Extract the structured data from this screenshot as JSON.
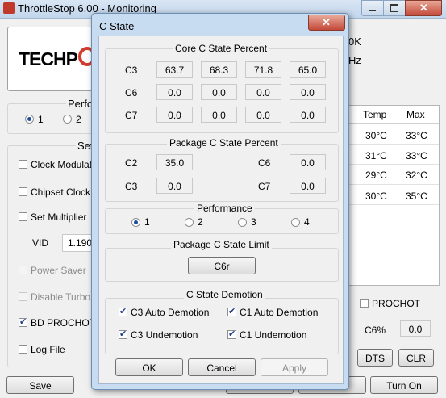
{
  "main_window": {
    "title": "ThrottleStop 6.00 - Monitoring",
    "logo_text": "TECHP",
    "header_right_1": "0K",
    "header_right_2": "Hz",
    "performance_label": "Perfo",
    "perf_radio_1": "1",
    "perf_radio_2": "2",
    "settings_label": "Set",
    "options": [
      {
        "label": "Clock Modulation",
        "checked": false,
        "enabled": true
      },
      {
        "label": "Chipset Clock M",
        "checked": false,
        "enabled": true
      },
      {
        "label": "Set Multiplier",
        "checked": false,
        "enabled": true
      },
      {
        "label": "Power Saver",
        "checked": false,
        "enabled": false
      },
      {
        "label": "Disable Turbo",
        "checked": false,
        "enabled": false
      },
      {
        "label": "BD PROCHOT",
        "checked": true,
        "enabled": true
      },
      {
        "label": "Log File",
        "checked": false,
        "enabled": true
      }
    ],
    "vid_label": "VID",
    "vid_value": "1.1908",
    "temp_table": {
      "headers": [
        "Temp",
        "Max"
      ],
      "rows": [
        [
          "30°C",
          "33°C"
        ],
        [
          "31°C",
          "33°C"
        ],
        [
          "29°C",
          "32°C"
        ],
        [
          "30°C",
          "35°C"
        ]
      ]
    },
    "prochot_label": "PROCHOT",
    "c6_label": "C6%",
    "c6_value": "0.0",
    "dts_button": "DTS",
    "clr_button": "CLR",
    "save_button": "Save",
    "turn_on_button": "Turn On"
  },
  "dialog": {
    "title": "C State",
    "close_glyph": "✕",
    "core_section": {
      "title": "Core C State Percent",
      "rows": [
        {
          "label": "C3",
          "values": [
            "63.7",
            "68.3",
            "71.8",
            "65.0"
          ]
        },
        {
          "label": "C6",
          "values": [
            "0.0",
            "0.0",
            "0.0",
            "0.0"
          ]
        },
        {
          "label": "C7",
          "values": [
            "0.0",
            "0.0",
            "0.0",
            "0.0"
          ]
        }
      ]
    },
    "package_section": {
      "title": "Package C State Percent",
      "c2_label": "C2",
      "c2_value": "35.0",
      "c6_label": "C6",
      "c6_value": "0.0",
      "c3_label": "C3",
      "c3_value": "0.0",
      "c7_label": "C7",
      "c7_value": "0.0"
    },
    "performance_section": {
      "title": "Performance",
      "options": [
        "1",
        "2",
        "3",
        "4"
      ],
      "selected": "1"
    },
    "limit_section": {
      "title": "Package C State Limit",
      "button": "C6r"
    },
    "demotion_section": {
      "title": "C State Demotion",
      "c3_auto": "C3 Auto Demotion",
      "c1_auto": "C1 Auto Demotion",
      "c3_undemotion": "C3 Undemotion",
      "c1_undemotion": "C1 Undemotion"
    },
    "ok_button": "OK",
    "cancel_button": "Cancel",
    "apply_button": "Apply"
  }
}
